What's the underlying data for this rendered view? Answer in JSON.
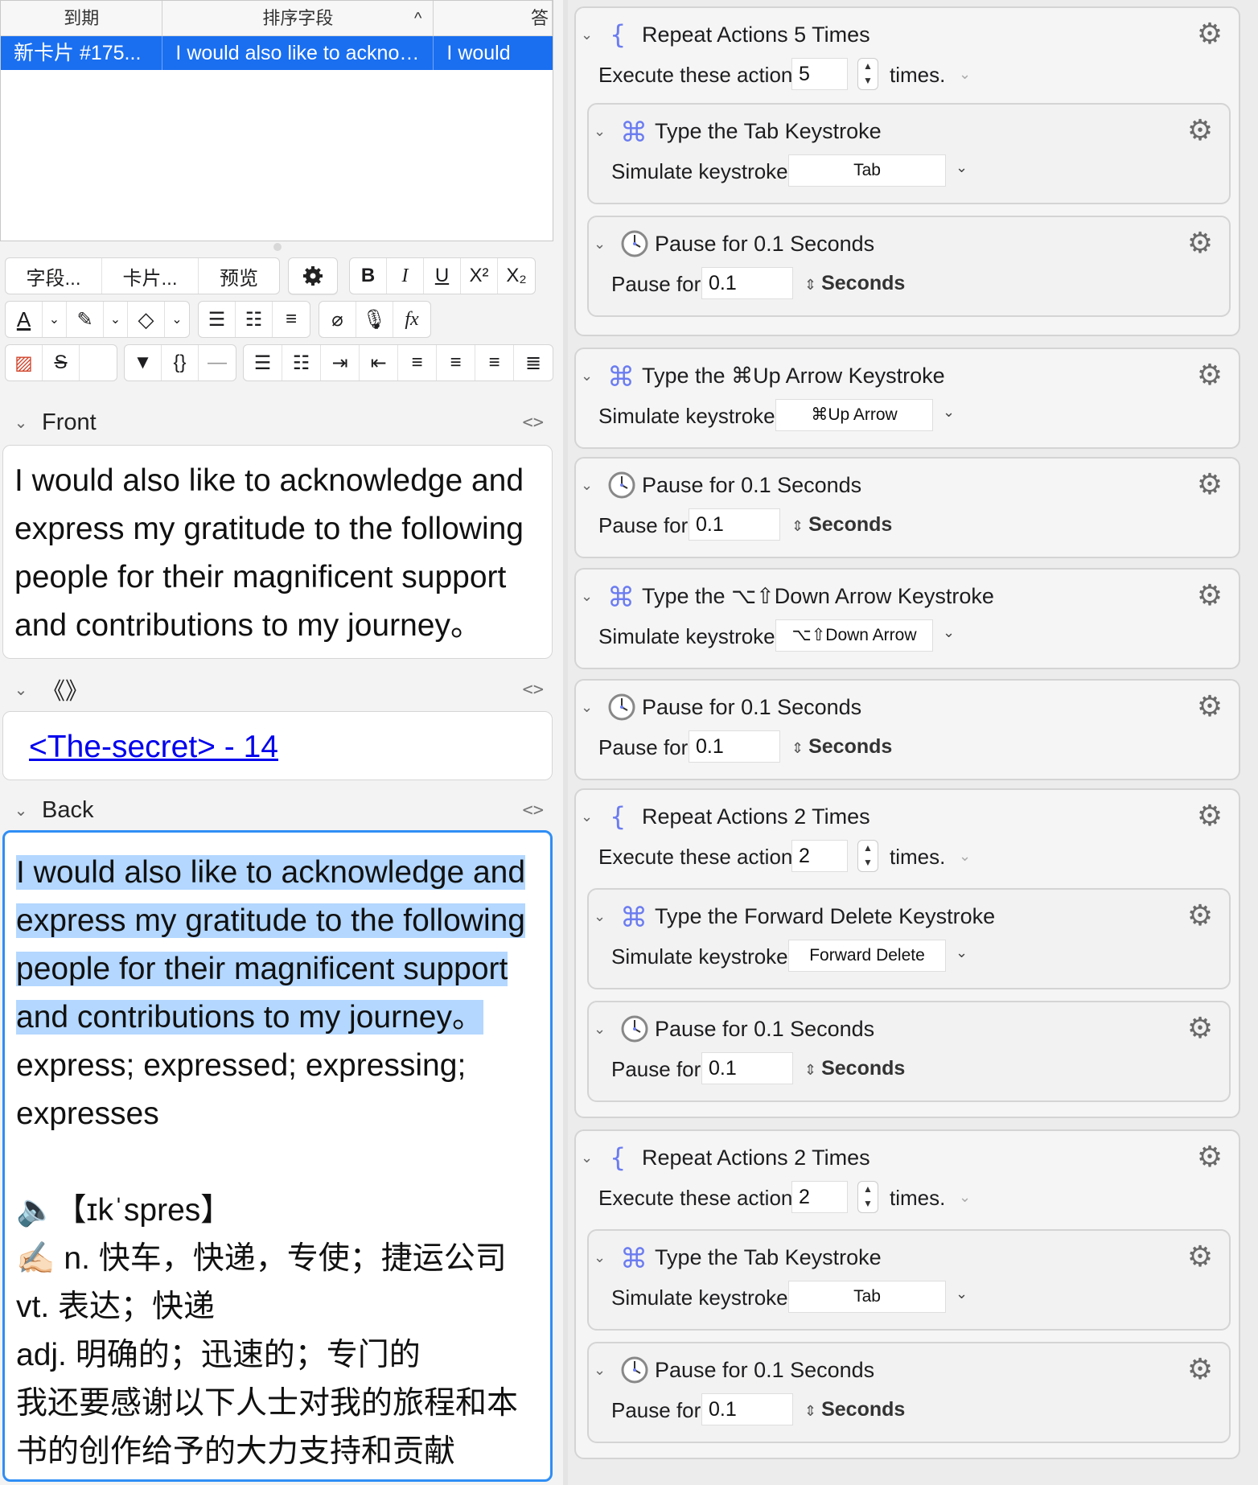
{
  "table": {
    "headers": [
      "到期",
      "排序字段",
      "答"
    ],
    "sort_indicator": "^",
    "row": [
      "新卡片 #175...",
      "I would also like to acknowledge ...",
      "I would"
    ]
  },
  "toolbar": {
    "row1": {
      "fields": "字段...",
      "cards": "卡片...",
      "preview": "预览",
      "bold": "B",
      "italic": "I",
      "underline": "U",
      "superscript": "X²",
      "subscript": "X₂"
    },
    "row2": {
      "text_color": "A",
      "formula": "fx"
    },
    "row3": {
      "triangle": "▼",
      "braces": "{}",
      "hr": "—"
    }
  },
  "fields": {
    "front": {
      "label": "Front",
      "code": "<>",
      "text": "I would also like to acknowledge and express my gratitude to the following people for their magnificent support and contributions to my journey。"
    },
    "source": {
      "label": "《》",
      "code": "<>",
      "link": "<The-secret> - 14"
    },
    "back": {
      "label": "Back",
      "code": "<>",
      "lines_highlighted": [
        "I would also like to acknowledge and",
        "express my gratitude to the following",
        "people for their magnificent support",
        "and contributions to my journey。"
      ],
      "lines": [
        "express; expressed; expressing;",
        "expresses",
        "",
        "🔈【ɪkˈspres】",
        "✍🏻 n. 快车，快递，专使；捷运公司",
        "vt. 表达；快递",
        "adj. 明确的；迅速的；专门的",
        "我还要感谢以下人士对我的旅程和本",
        "书的创作给予的大力支持和贡献"
      ]
    }
  },
  "macro": {
    "actions": [
      {
        "type": "repeat",
        "title": "Repeat Actions 5 Times",
        "label": "Execute these actions",
        "value": "5",
        "suffix": "times."
      },
      {
        "type": "keystroke",
        "title": "Type the Tab Keystroke",
        "label": "Simulate keystroke:",
        "value": "Tab"
      },
      {
        "type": "pause",
        "title": "Pause for 0.1 Seconds",
        "label": "Pause for",
        "value": "0.1",
        "unit": "Seconds"
      },
      {
        "type": "keystroke",
        "title": "Type the ⌘Up Arrow Keystroke",
        "label": "Simulate keystroke:",
        "value": "⌘Up Arrow"
      },
      {
        "type": "pause",
        "title": "Pause for 0.1 Seconds",
        "label": "Pause for",
        "value": "0.1",
        "unit": "Seconds"
      },
      {
        "type": "keystroke",
        "title": "Type the ⌥⇧Down Arrow Keystroke",
        "label": "Simulate keystroke:",
        "value": "⌥⇧Down Arrow"
      },
      {
        "type": "pause",
        "title": "Pause for 0.1 Seconds",
        "label": "Pause for",
        "value": "0.1",
        "unit": "Seconds"
      },
      {
        "type": "repeat",
        "title": "Repeat Actions 2 Times",
        "label": "Execute these actions",
        "value": "2",
        "suffix": "times."
      },
      {
        "type": "keystroke",
        "title": "Type the Forward Delete Keystroke",
        "label": "Simulate keystroke:",
        "value": "Forward Delete"
      },
      {
        "type": "pause",
        "title": "Pause for 0.1 Seconds",
        "label": "Pause for",
        "value": "0.1",
        "unit": "Seconds"
      },
      {
        "type": "repeat",
        "title": "Repeat Actions 2 Times",
        "label": "Execute these actions",
        "value": "2",
        "suffix": "times."
      },
      {
        "type": "keystroke",
        "title": "Type the Tab Keystroke",
        "label": "Simulate keystroke:",
        "value": "Tab"
      },
      {
        "type": "pause",
        "title": "Pause for 0.1 Seconds",
        "label": "Pause for",
        "value": "0.1",
        "unit": "Seconds"
      }
    ]
  },
  "colors": {
    "selection": "#1a6ff0",
    "highlight": "#b3d7ff",
    "focus": "#2f8ef5",
    "icon_accent": "#6b7cf0"
  }
}
